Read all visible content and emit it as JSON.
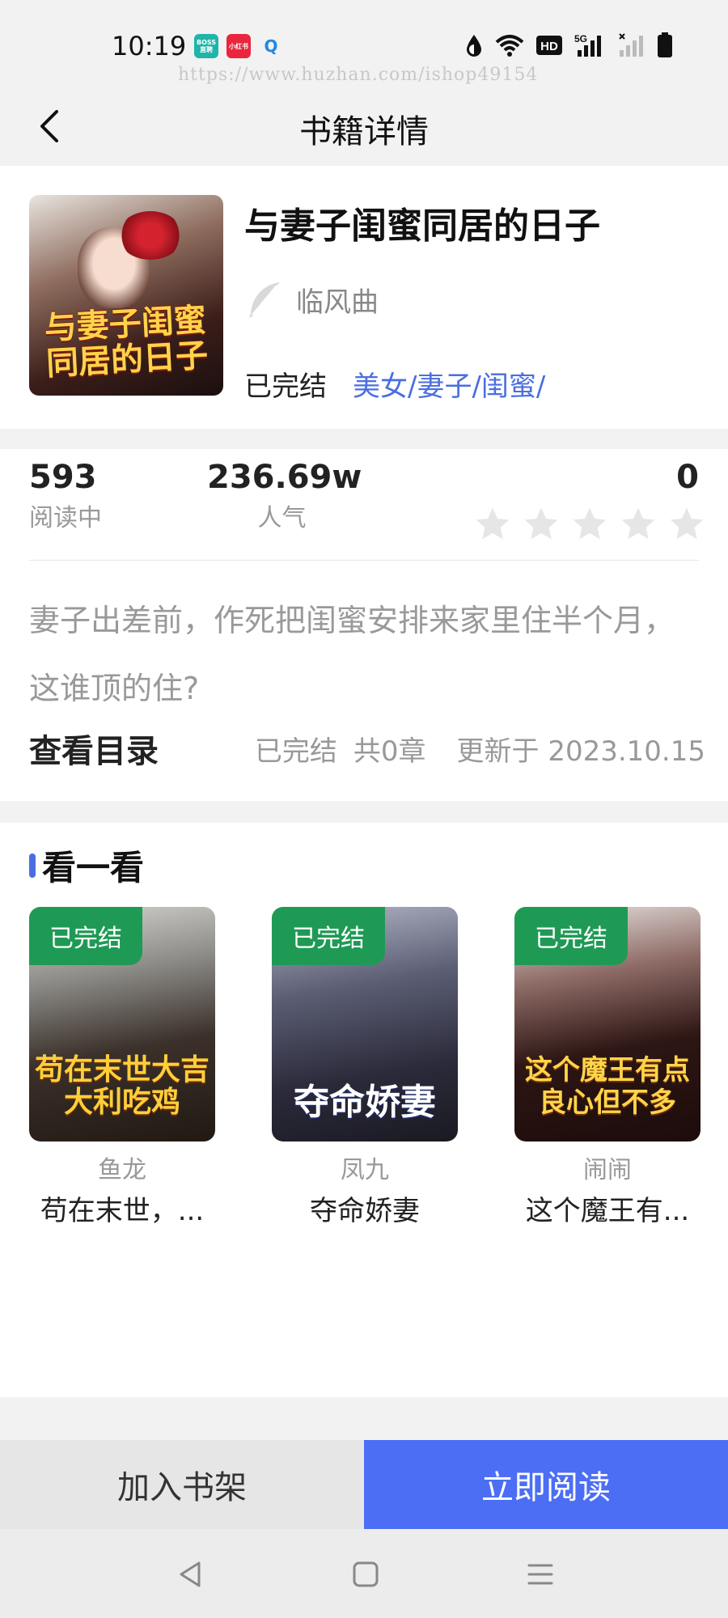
{
  "status_bar": {
    "time": "10:19",
    "apps": [
      "BOSS直聘",
      "小红书",
      "Q"
    ],
    "network": "5G",
    "hd": "HD"
  },
  "watermark": "https://www.huzhan.com/ishop49154",
  "header": {
    "title": "书籍详情"
  },
  "book": {
    "title": "与妻子闺蜜同居的日子",
    "cover_text": "与妻子闺蜜同居的日子",
    "author": "临风曲",
    "status": "已完结",
    "tags": "美女/妻子/闺蜜/"
  },
  "stats": {
    "reading_value": "593",
    "reading_label": "阅读中",
    "popularity_value": "236.69w",
    "popularity_label": "人气",
    "score_value": "0",
    "stars_filled": 0,
    "stars_total": 5
  },
  "synopsis": "妻子出差前，作死把闺蜜安排来家里住半个月，这谁顶的住?",
  "catalog": {
    "link": "查看目录",
    "status": "已完结",
    "chapters": "共0章",
    "updated": "更新于 2023.10.15"
  },
  "recommend": {
    "heading": "看一看",
    "items": [
      {
        "badge": "已完结",
        "cover_text": "苟在末世大吉大利吃鸡",
        "author": "鱼龙",
        "name": "苟在末世，..."
      },
      {
        "badge": "已完结",
        "cover_text": "夺命娇妻",
        "author": "凤九",
        "name": "夺命娇妻"
      },
      {
        "badge": "已完结",
        "cover_text": "这个魔王有点良心但不多",
        "author": "闹闹",
        "name": "这个魔王有..."
      }
    ]
  },
  "actions": {
    "add_shelf": "加入书架",
    "read_now": "立即阅读"
  },
  "colors": {
    "accent": "#4c6ef5",
    "tag_blue": "#4a6ee0",
    "badge_green": "#1f9a55",
    "star_gray": "#e6e6e6"
  }
}
